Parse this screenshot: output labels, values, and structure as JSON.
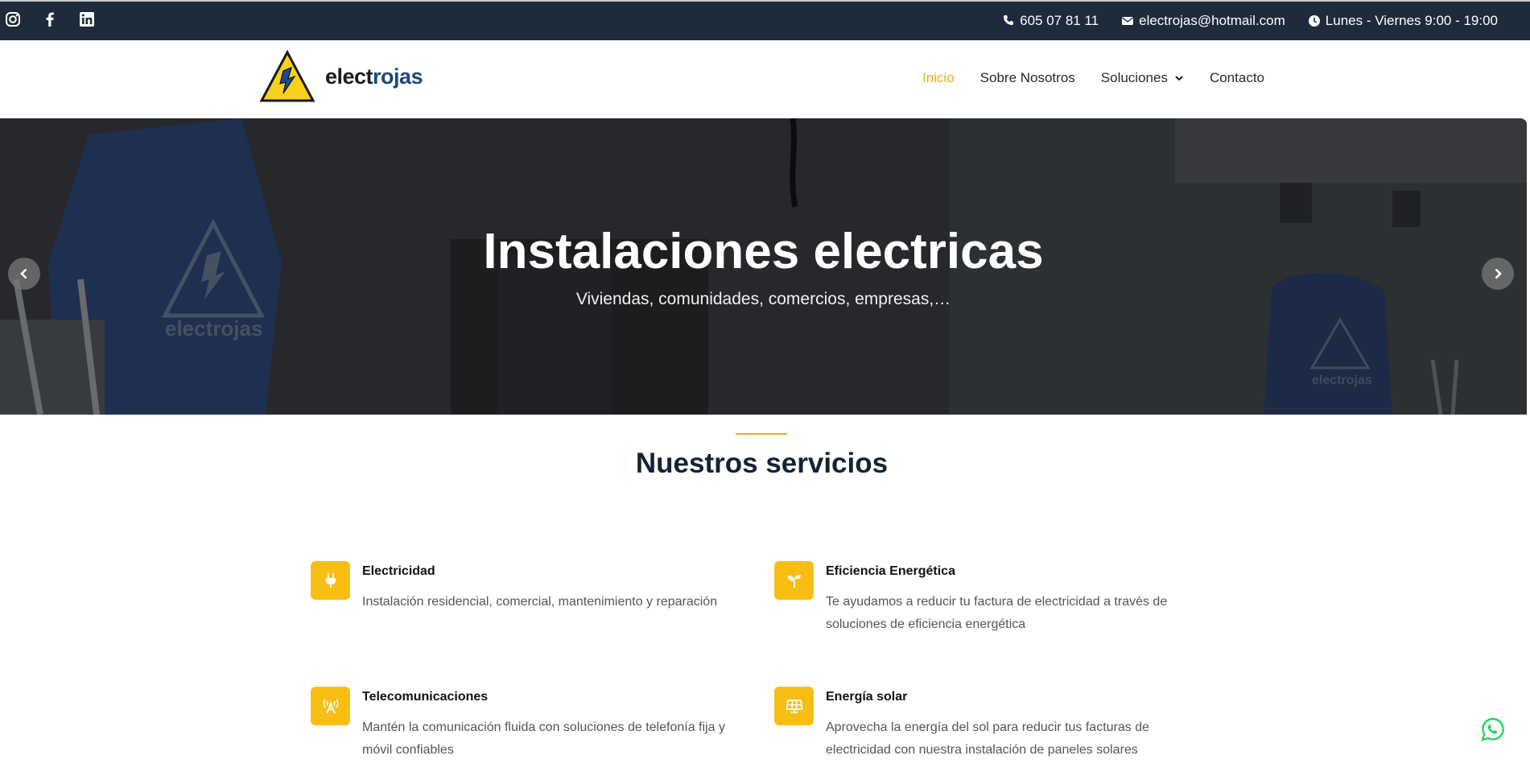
{
  "topbar": {
    "social": [
      {
        "icon": "instagram-icon"
      },
      {
        "icon": "facebook-icon"
      },
      {
        "icon": "linkedin-icon"
      }
    ],
    "phone": "605 07 81 11",
    "email": "electrojas@hotmail.com",
    "hours": "Lunes - Viernes 9:00 - 19:00"
  },
  "header": {
    "logo_part1": "elect",
    "logo_part2": "rojas",
    "nav": [
      {
        "label": "Inicio",
        "active": true
      },
      {
        "label": "Sobre Nosotros"
      },
      {
        "label": "Soluciones",
        "dropdown": true
      },
      {
        "label": "Contacto"
      }
    ]
  },
  "hero": {
    "title": "Instalaciones electricas",
    "subtitle": "Viviendas, comunidades, comercios, empresas,…",
    "shirt_text": "electrojas"
  },
  "services": {
    "title": "Nuestros servicios",
    "items": [
      {
        "title": "Electricidad",
        "desc": "Instalación residencial, comercial, mantenimiento y reparación",
        "icon": "plug-icon"
      },
      {
        "title": "Eficiencia Energética",
        "desc": "Te ayudamos a reducir tu factura de electricidad a través de soluciones de eficiencia energética",
        "icon": "seedling-icon"
      },
      {
        "title": "Telecomunicaciones",
        "desc": "Mantén la comunicación fluida con soluciones de telefonía fija y móvil confiables",
        "icon": "antenna-icon"
      },
      {
        "title": "Energía solar",
        "desc": "Aprovecha la energía del sol para reducir tus facturas de electricidad con nuestra instalación de paneles solares",
        "icon": "solar-panel-icon"
      }
    ]
  },
  "colors": {
    "topbar_bg": "#1e2b3a",
    "accent": "#f2a81d",
    "icon_bg": "#f8be14",
    "whatsapp": "#25d366"
  }
}
